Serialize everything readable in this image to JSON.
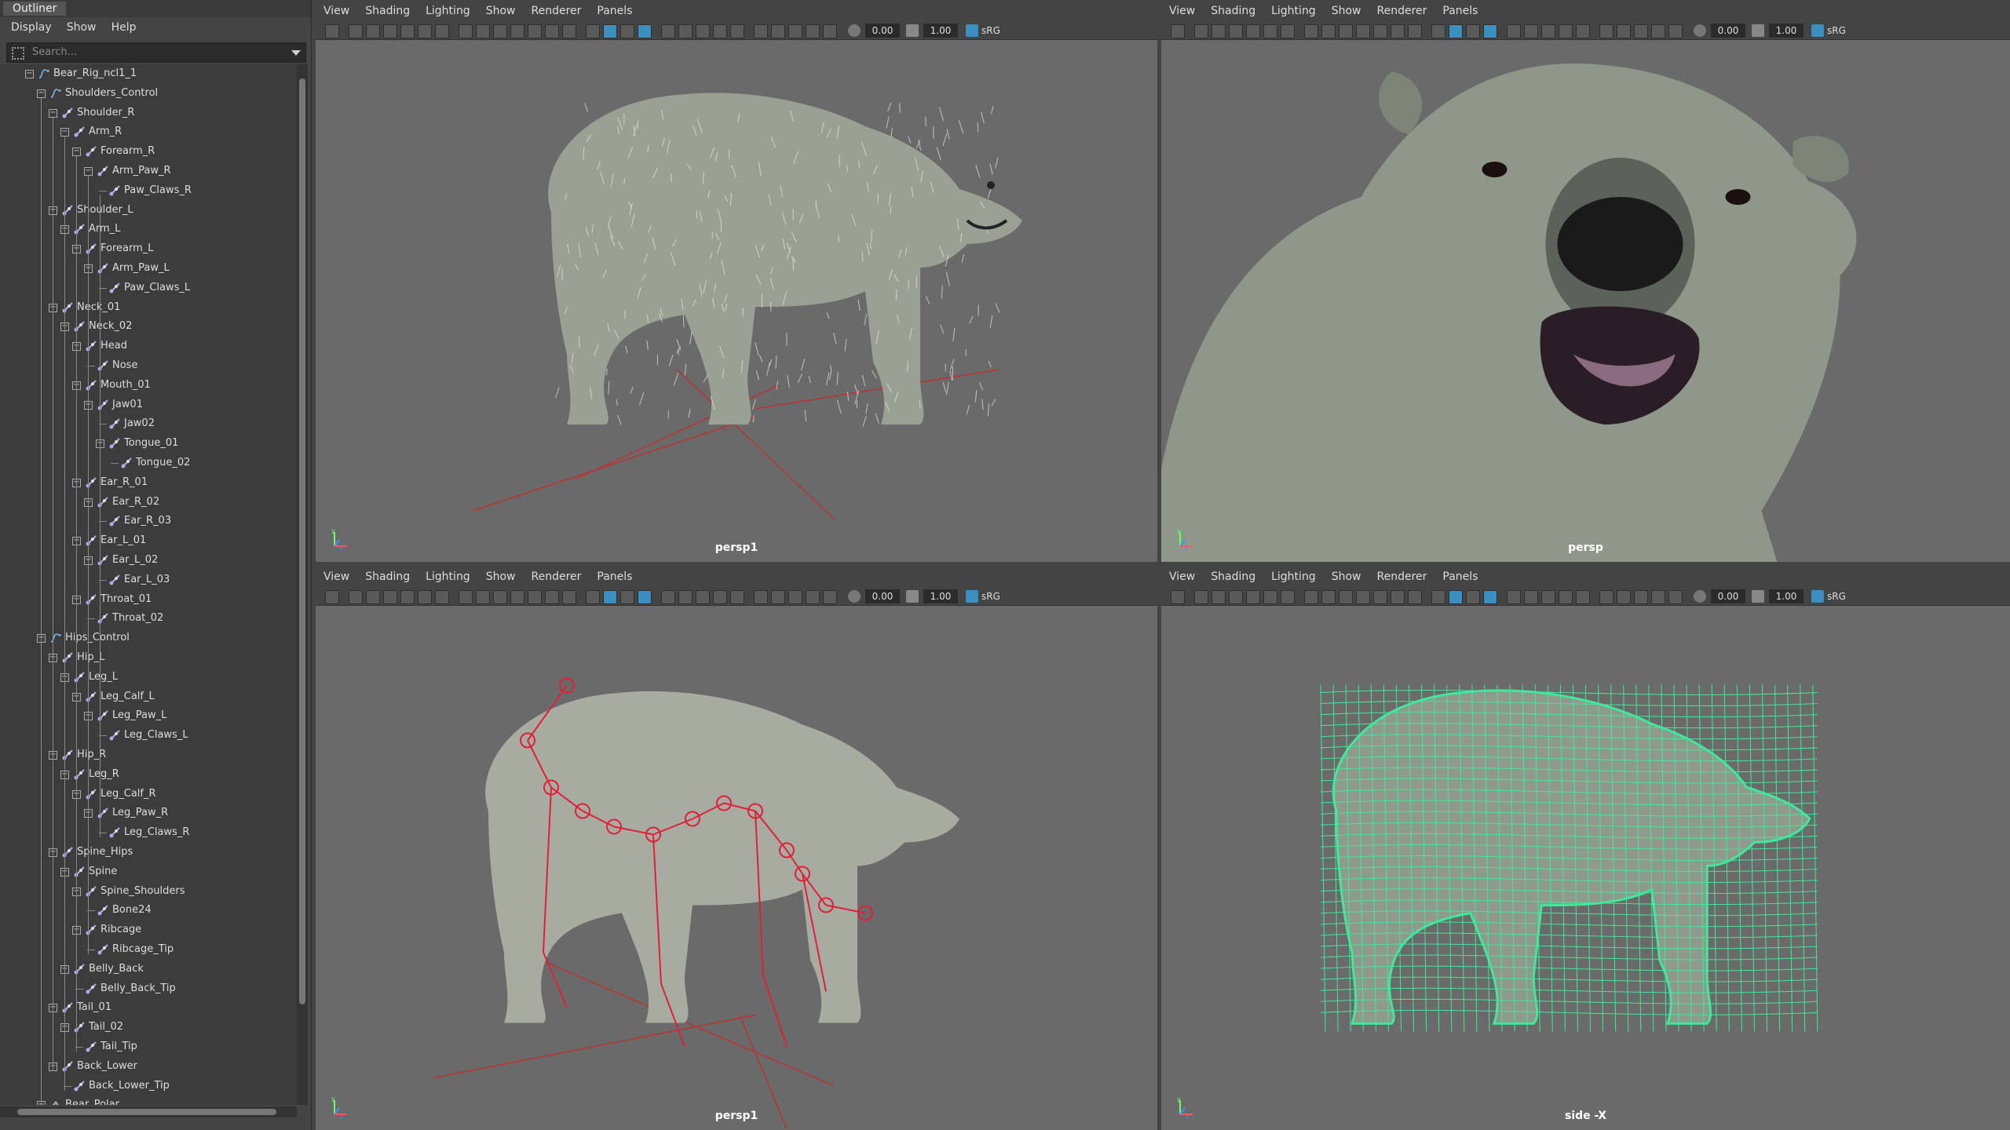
{
  "outliner": {
    "title": "Outliner",
    "menu": [
      "Display",
      "Show",
      "Help"
    ],
    "search_placeholder": "Search...",
    "tree": [
      {
        "label": "Bear_Rig_ncl1_1",
        "depth": 0,
        "type": "curve"
      },
      {
        "label": "Shoulders_Control",
        "depth": 1,
        "type": "curve"
      },
      {
        "label": "Shoulder_R",
        "depth": 2,
        "type": "joint"
      },
      {
        "label": "Arm_R",
        "depth": 3,
        "type": "joint"
      },
      {
        "label": "Forearm_R",
        "depth": 4,
        "type": "joint"
      },
      {
        "label": "Arm_Paw_R",
        "depth": 5,
        "type": "joint"
      },
      {
        "label": "Paw_Claws_R",
        "depth": 6,
        "type": "joint",
        "leaf": true
      },
      {
        "label": "Shoulder_L",
        "depth": 2,
        "type": "joint"
      },
      {
        "label": "Arm_L",
        "depth": 3,
        "type": "joint"
      },
      {
        "label": "Forearm_L",
        "depth": 4,
        "type": "joint"
      },
      {
        "label": "Arm_Paw_L",
        "depth": 5,
        "type": "joint"
      },
      {
        "label": "Paw_Claws_L",
        "depth": 6,
        "type": "joint",
        "leaf": true
      },
      {
        "label": "Neck_01",
        "depth": 2,
        "type": "joint"
      },
      {
        "label": "Neck_02",
        "depth": 3,
        "type": "joint"
      },
      {
        "label": "Head",
        "depth": 4,
        "type": "joint"
      },
      {
        "label": "Nose",
        "depth": 5,
        "type": "joint",
        "leaf": true
      },
      {
        "label": "Mouth_01",
        "depth": 4,
        "type": "joint"
      },
      {
        "label": "Jaw01",
        "depth": 5,
        "type": "joint"
      },
      {
        "label": "Jaw02",
        "depth": 6,
        "type": "joint",
        "leaf": true
      },
      {
        "label": "Tongue_01",
        "depth": 6,
        "type": "joint"
      },
      {
        "label": "Tongue_02",
        "depth": 7,
        "type": "joint",
        "leaf": true
      },
      {
        "label": "Ear_R_01",
        "depth": 4,
        "type": "joint"
      },
      {
        "label": "Ear_R_02",
        "depth": 5,
        "type": "joint"
      },
      {
        "label": "Ear_R_03",
        "depth": 6,
        "type": "joint",
        "leaf": true
      },
      {
        "label": "Ear_L_01",
        "depth": 4,
        "type": "joint"
      },
      {
        "label": "Ear_L_02",
        "depth": 5,
        "type": "joint"
      },
      {
        "label": "Ear_L_03",
        "depth": 6,
        "type": "joint",
        "leaf": true
      },
      {
        "label": "Throat_01",
        "depth": 4,
        "type": "joint"
      },
      {
        "label": "Throat_02",
        "depth": 5,
        "type": "joint",
        "leaf": true
      },
      {
        "label": "Hips_Control",
        "depth": 1,
        "type": "curve"
      },
      {
        "label": "Hip_L",
        "depth": 2,
        "type": "joint"
      },
      {
        "label": "Leg_L",
        "depth": 3,
        "type": "joint"
      },
      {
        "label": "Leg_Calf_L",
        "depth": 4,
        "type": "joint"
      },
      {
        "label": "Leg_Paw_L",
        "depth": 5,
        "type": "joint"
      },
      {
        "label": "Leg_Claws_L",
        "depth": 6,
        "type": "joint",
        "leaf": true
      },
      {
        "label": "Hip_R",
        "depth": 2,
        "type": "joint"
      },
      {
        "label": "Leg_R",
        "depth": 3,
        "type": "joint"
      },
      {
        "label": "Leg_Calf_R",
        "depth": 4,
        "type": "joint"
      },
      {
        "label": "Leg_Paw_R",
        "depth": 5,
        "type": "joint"
      },
      {
        "label": "Leg_Claws_R",
        "depth": 6,
        "type": "joint",
        "leaf": true
      },
      {
        "label": "Spine_Hips",
        "depth": 2,
        "type": "joint"
      },
      {
        "label": "Spine",
        "depth": 3,
        "type": "joint"
      },
      {
        "label": "Spine_Shoulders",
        "depth": 4,
        "type": "joint"
      },
      {
        "label": "Bone24",
        "depth": 5,
        "type": "joint",
        "leaf": true
      },
      {
        "label": "Ribcage",
        "depth": 4,
        "type": "joint"
      },
      {
        "label": "Ribcage_Tip",
        "depth": 5,
        "type": "joint",
        "leaf": true
      },
      {
        "label": "Belly_Back",
        "depth": 3,
        "type": "joint"
      },
      {
        "label": "Belly_Back_Tip",
        "depth": 4,
        "type": "joint",
        "leaf": true
      },
      {
        "label": "Tail_01",
        "depth": 2,
        "type": "joint"
      },
      {
        "label": "Tail_02",
        "depth": 3,
        "type": "joint"
      },
      {
        "label": "Tail_Tip",
        "depth": 4,
        "type": "joint",
        "leaf": true
      },
      {
        "label": "Back_Lower",
        "depth": 2,
        "type": "joint"
      },
      {
        "label": "Back_Lower_Tip",
        "depth": 3,
        "type": "joint",
        "leaf": true
      },
      {
        "label": "Bear_Polar",
        "depth": 1,
        "type": "mesh"
      }
    ]
  },
  "viewport_menu": [
    "View",
    "Shading",
    "Lighting",
    "Show",
    "Renderer",
    "Panels"
  ],
  "toolbar": {
    "exposure": "0.00",
    "gamma": "1.00",
    "color_space": "sRG"
  },
  "viewports": [
    {
      "id": "top-left",
      "camera": "persp1",
      "content": "fur"
    },
    {
      "id": "top-right",
      "camera": "persp",
      "content": "closeup"
    },
    {
      "id": "bottom-left",
      "camera": "persp1",
      "content": "skeleton"
    },
    {
      "id": "bottom-right",
      "camera": "side -X",
      "content": "wireframe"
    }
  ],
  "colors": {
    "viewport_bg": "#6a6a6a",
    "joint": "#e0203a",
    "wireframe": "#3fe89a",
    "joint_icon": "#b9a8e8",
    "curve_icon": "#7fb3e6"
  },
  "icons": {
    "axis_gizmo": "axis-gizmo-icon",
    "joint": "joint-icon",
    "curve": "curve-icon",
    "mesh": "mesh-icon"
  }
}
